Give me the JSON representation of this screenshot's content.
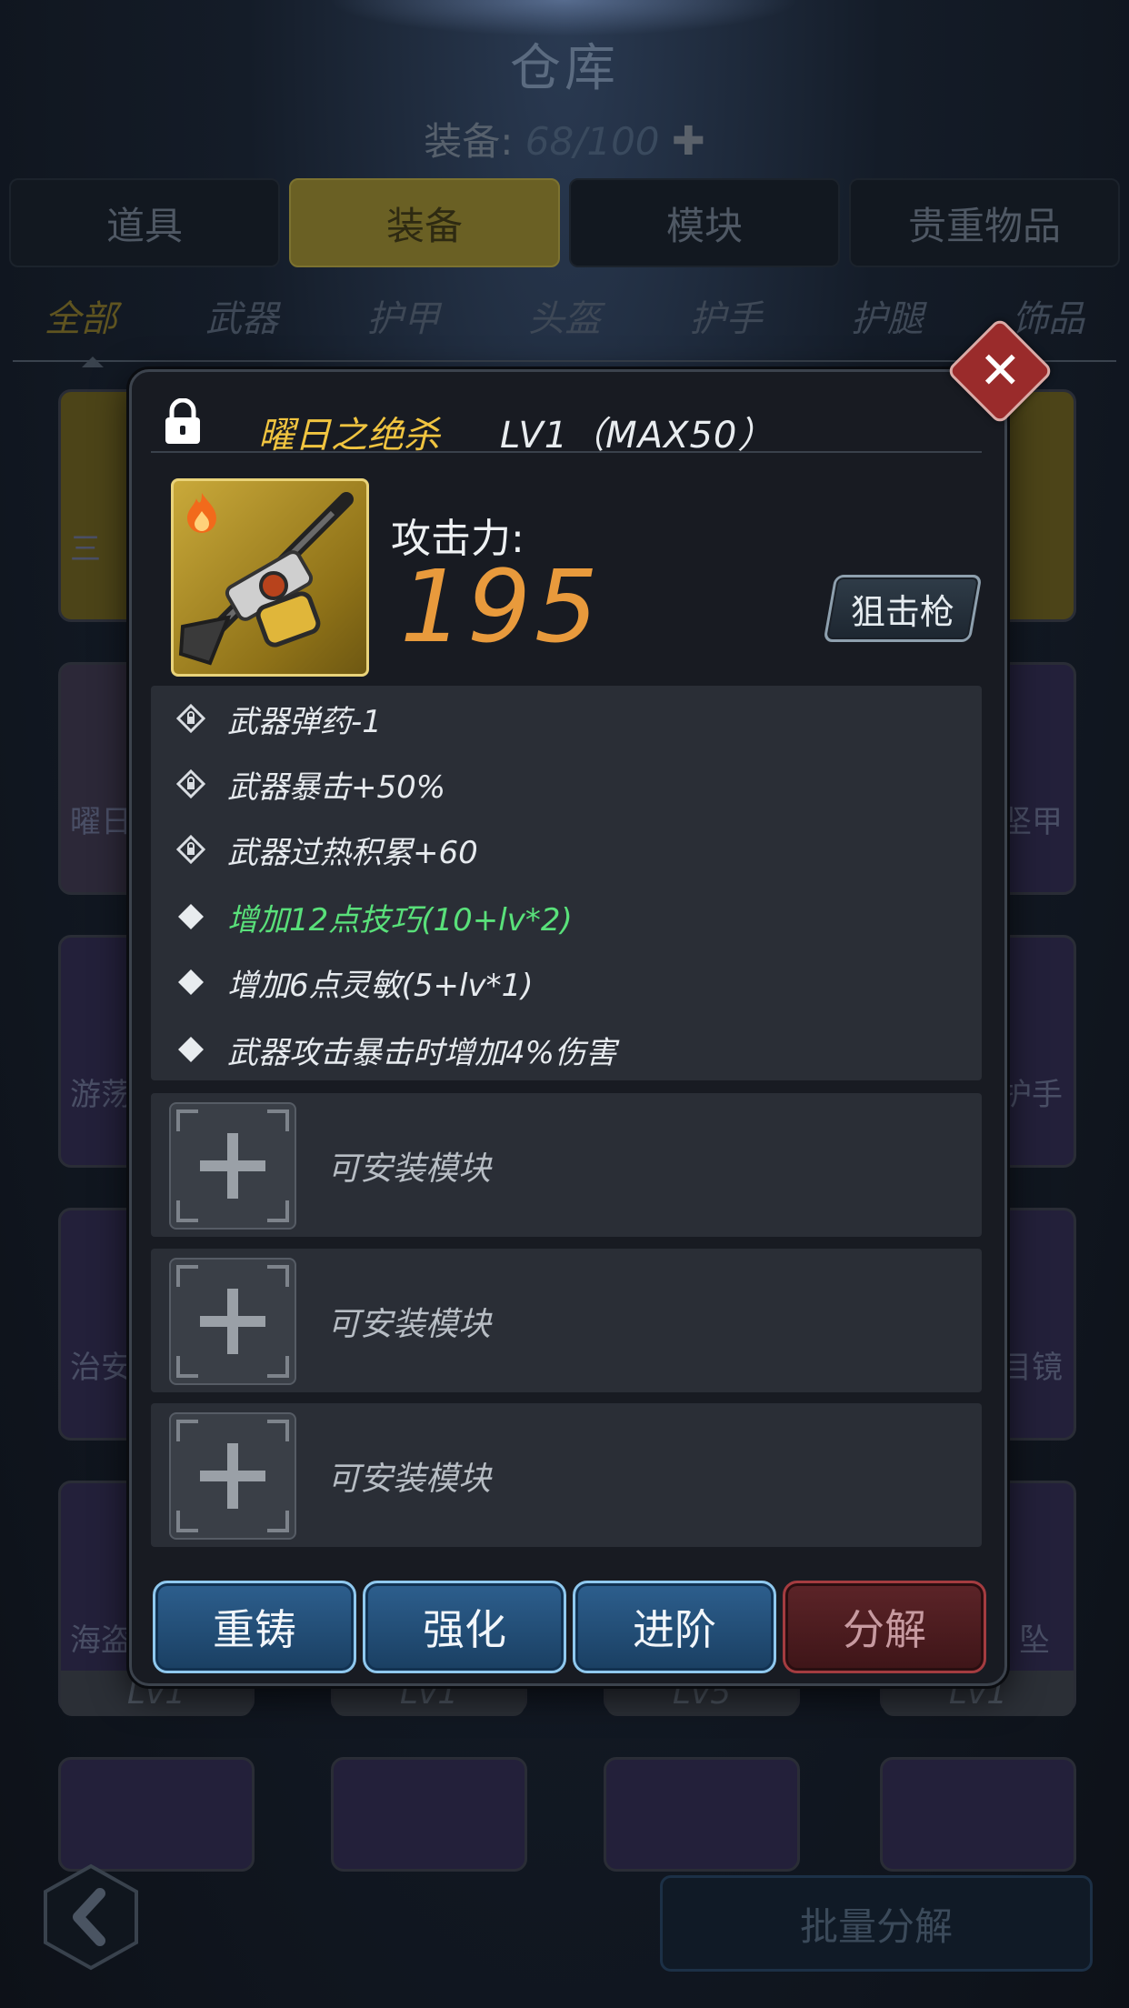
{
  "background": {
    "title": "仓库",
    "capacity": {
      "label": "装备:",
      "value": "68/100",
      "add_icon": "cross-icon"
    },
    "tabs": [
      {
        "label": "道具",
        "active": false
      },
      {
        "label": "装备",
        "active": true
      },
      {
        "label": "模块",
        "active": false
      },
      {
        "label": "贵重物品",
        "active": false
      }
    ],
    "filters": [
      {
        "label": "全部",
        "active": true
      },
      {
        "label": "武器",
        "active": false
      },
      {
        "label": "护甲",
        "active": false
      },
      {
        "label": "头盔",
        "active": false
      },
      {
        "label": "护手",
        "active": false
      },
      {
        "label": "护腿",
        "active": false
      },
      {
        "label": "饰品",
        "active": false
      }
    ],
    "visible_card_fragments": [
      "三",
      "曜日",
      "游荡",
      "治安",
      "海盗",
      "坚甲",
      "护手",
      "目镜",
      "坠"
    ],
    "card_levels": [
      "Lv1",
      "Lv1",
      "Lv5",
      "Lv1"
    ],
    "batch_button": "批量分解",
    "back_icon": "back-arrow-icon"
  },
  "modal": {
    "item_name": "曜日之绝杀",
    "level_text": "LV1（MAX50）",
    "attack_label": "攻击力:",
    "attack_value": "195",
    "weapon_type": "狙击枪",
    "attributes": [
      {
        "text": "武器弹药-1",
        "icon": "locked-diamond-icon",
        "highlight": false
      },
      {
        "text": "武器暴击+50%",
        "icon": "locked-diamond-icon",
        "highlight": false
      },
      {
        "text": "武器过热积累+60",
        "icon": "locked-diamond-icon",
        "highlight": false
      },
      {
        "text": "增加12点技巧(10+lv*2)",
        "icon": "diamond-icon",
        "highlight": true
      },
      {
        "text": "增加6点灵敏(5+lv*1)",
        "icon": "diamond-icon",
        "highlight": false
      },
      {
        "text": "武器攻击暴击时增加4%伤害",
        "icon": "diamond-icon",
        "highlight": false
      }
    ],
    "module_slots": [
      {
        "label": "可安装模块"
      },
      {
        "label": "可安装模块"
      },
      {
        "label": "可安装模块"
      }
    ],
    "actions": {
      "recast": "重铸",
      "enhance": "强化",
      "advance": "进阶",
      "disassemble": "分解"
    },
    "colors": {
      "name": "#f0c440",
      "attack": "#e89a3c",
      "highlight_attr": "#59e07a"
    }
  }
}
